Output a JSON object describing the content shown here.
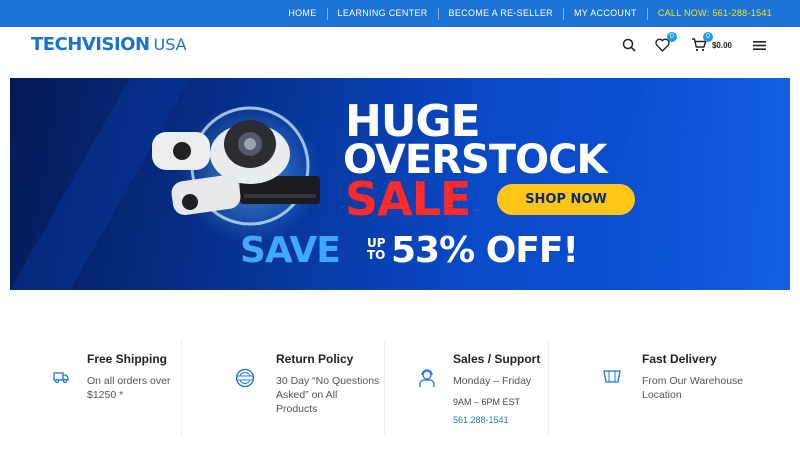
{
  "topnav": {
    "items": [
      "HOME",
      "LEARNING CENTER",
      "BECOME A RE-SELLER",
      "MY ACCOUNT"
    ],
    "call": "CALL NOW: 561-288-1541"
  },
  "header": {
    "logo_main": "TECHVISION",
    "logo_sub": "USA",
    "wishlist_count": "0",
    "cart_count": "0",
    "cart_total": "$0.00",
    "icons": [
      "search-icon",
      "heart-icon",
      "cart-icon",
      "hamburger-menu-icon"
    ]
  },
  "hero": {
    "line1": "HUGE",
    "line2": "OVERSTOCK",
    "line3": "SALE",
    "button": "SHOP NOW",
    "save": "SAVE",
    "upto": "UP TO",
    "percent": "53% OFF!"
  },
  "features": [
    {
      "icon": "delivery-truck-icon",
      "title": "Free Shipping",
      "text": "On all orders over $1250 *"
    },
    {
      "icon": "guarantee-badge-icon",
      "title": "Return Policy",
      "text": "30 Day “No Questions Asked” on All Products"
    },
    {
      "icon": "support-agent-icon",
      "title": "Sales / Support",
      "text": "Monday – Friday",
      "extra": "9AM – 6PM EST",
      "link": "561.288-1541"
    },
    {
      "icon": "warehouse-icon",
      "title": "Fast Delivery",
      "text": "From Our Warehouse Location"
    }
  ],
  "colors": {
    "brand_blue": "#1d74d8",
    "call_yellow": "#ffe600",
    "sale_red": "#ff2a2a",
    "button_yellow": "#ffc615"
  }
}
